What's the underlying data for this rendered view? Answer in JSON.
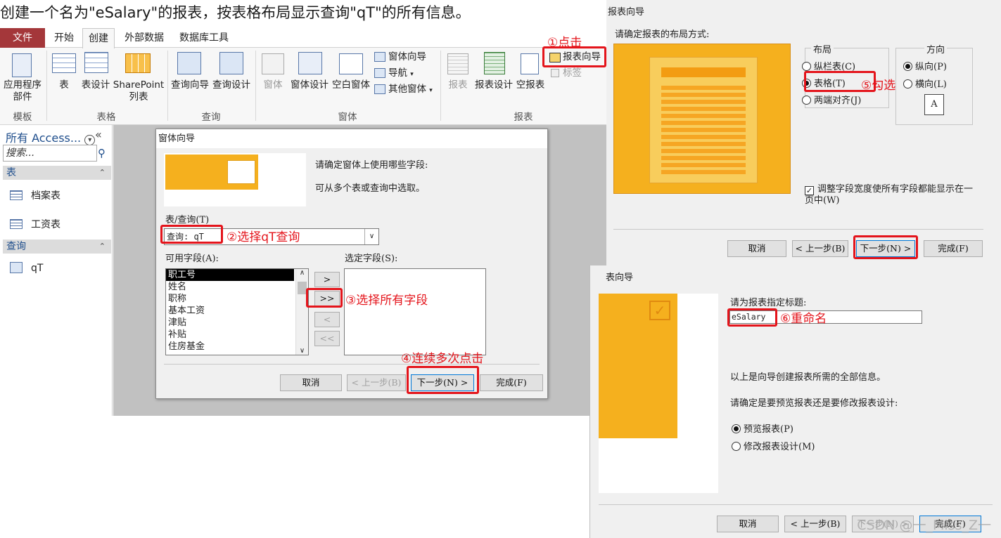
{
  "heading": "创建一个名为\"eSalary\"的报表，按表格布局显示查询\"qT\"的所有信息。",
  "ribbon": {
    "tabs": [
      "文件",
      "开始",
      "创建",
      "外部数据",
      "数据库工具"
    ],
    "buttons": {
      "app_parts": "应用程序部件",
      "table": "表",
      "table_design": "表设计",
      "sharepoint_lists": "SharePoint列表",
      "query_wizard": "查询向导",
      "query_design": "查询设计",
      "form": "窗体",
      "form_design": "窗体设计",
      "blank_form": "空白窗体",
      "form_wizard": "窗体向导",
      "navigation": "导航",
      "more_forms": "其他窗体",
      "report": "报表",
      "report_design": "报表设计",
      "blank_report": "空报表",
      "report_wizard": "报表向导",
      "labels": "标签"
    },
    "groups": [
      "模板",
      "表格",
      "查询",
      "窗体",
      "报表"
    ]
  },
  "nav": {
    "header": "所有 Access...",
    "search_placeholder": "搜索...",
    "section_tables": "表",
    "tables": [
      "档案表",
      "工资表"
    ],
    "section_queries": "查询",
    "queries": [
      "qT"
    ]
  },
  "form_wizard": {
    "title": "窗体向导",
    "prompt": "请确定窗体上使用哪些字段:",
    "hint": "可从多个表或查询中选取。",
    "table_query_label": "表/查询(T)",
    "table_query_value": "查询: qT",
    "available_label": "可用字段(A):",
    "selected_label": "选定字段(S):",
    "fields": [
      "职工号",
      "姓名",
      "职称",
      "基本工资",
      "津贴",
      "补贴",
      "住房基金"
    ],
    "move_buttons": [
      ">",
      ">>",
      "<",
      "<<"
    ],
    "cancel": "取消",
    "back": "< 上一步(B)",
    "next": "下一步(N) >",
    "finish": "完成(F)"
  },
  "report_wizard_layout": {
    "title": "报表向导",
    "prompt": "请确定报表的布局方式:",
    "layout_legend": "布局",
    "layout_options": [
      "纵栏表(C)",
      "表格(T)",
      "两端对齐(J)"
    ],
    "orientation_legend": "方向",
    "orientation_options": [
      "纵向(P)",
      "横向(L)"
    ],
    "page_icon_letter": "A",
    "fit_checkbox": "调整字段宽度使所有字段都能显示在一页中(W)",
    "cancel": "取消",
    "back": "< 上一步(B)",
    "next": "下一步(N) >",
    "finish": "完成(F)"
  },
  "report_wizard_title": {
    "title": "表向导",
    "prompt": "请为报表指定标题:",
    "title_value": "eSalary",
    "info": "以上是向导创建报表所需的全部信息。",
    "question": "请确定是要预览报表还是要修改报表设计:",
    "options": [
      "预览报表(P)",
      "修改报表设计(M)"
    ],
    "cancel": "取消",
    "back": "< 上一步(B)",
    "next": "下一步(N) >",
    "finish": "完成(F)"
  },
  "annotations": {
    "a1": "①点击",
    "a2": "②选择qT查询",
    "a3": "③选择所有字段",
    "a4": "④连续多次点击",
    "a5": "⑤勾选",
    "a6": "⑥重命名"
  },
  "watermark": "CSDN @一_Miss_Z一",
  "colors": {
    "annotation": "#e4141b",
    "file_tab": "#a4373a",
    "wizard_art": "#f5b01e"
  }
}
